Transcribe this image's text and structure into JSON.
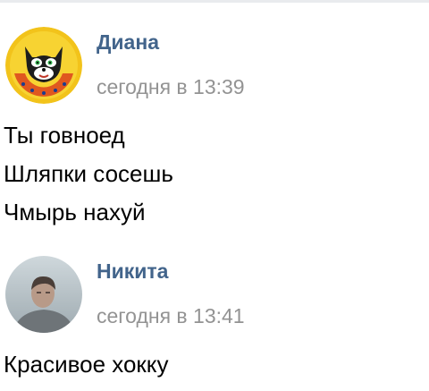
{
  "messages": [
    {
      "author": "Диана",
      "time": "сегодня в 13:39",
      "avatar_icon": "cartoon-cat-avatar",
      "lines": [
        "Ты говноед",
        "Шляпки сосешь",
        "Чмырь нахуй"
      ]
    },
    {
      "author": "Никита",
      "time": "сегодня в 13:41",
      "avatar_icon": "person-photo-avatar",
      "lines": [
        "Красивое хокку"
      ]
    }
  ],
  "colors": {
    "author_name": "#42648b",
    "timestamp": "#939393",
    "text": "#000000"
  }
}
